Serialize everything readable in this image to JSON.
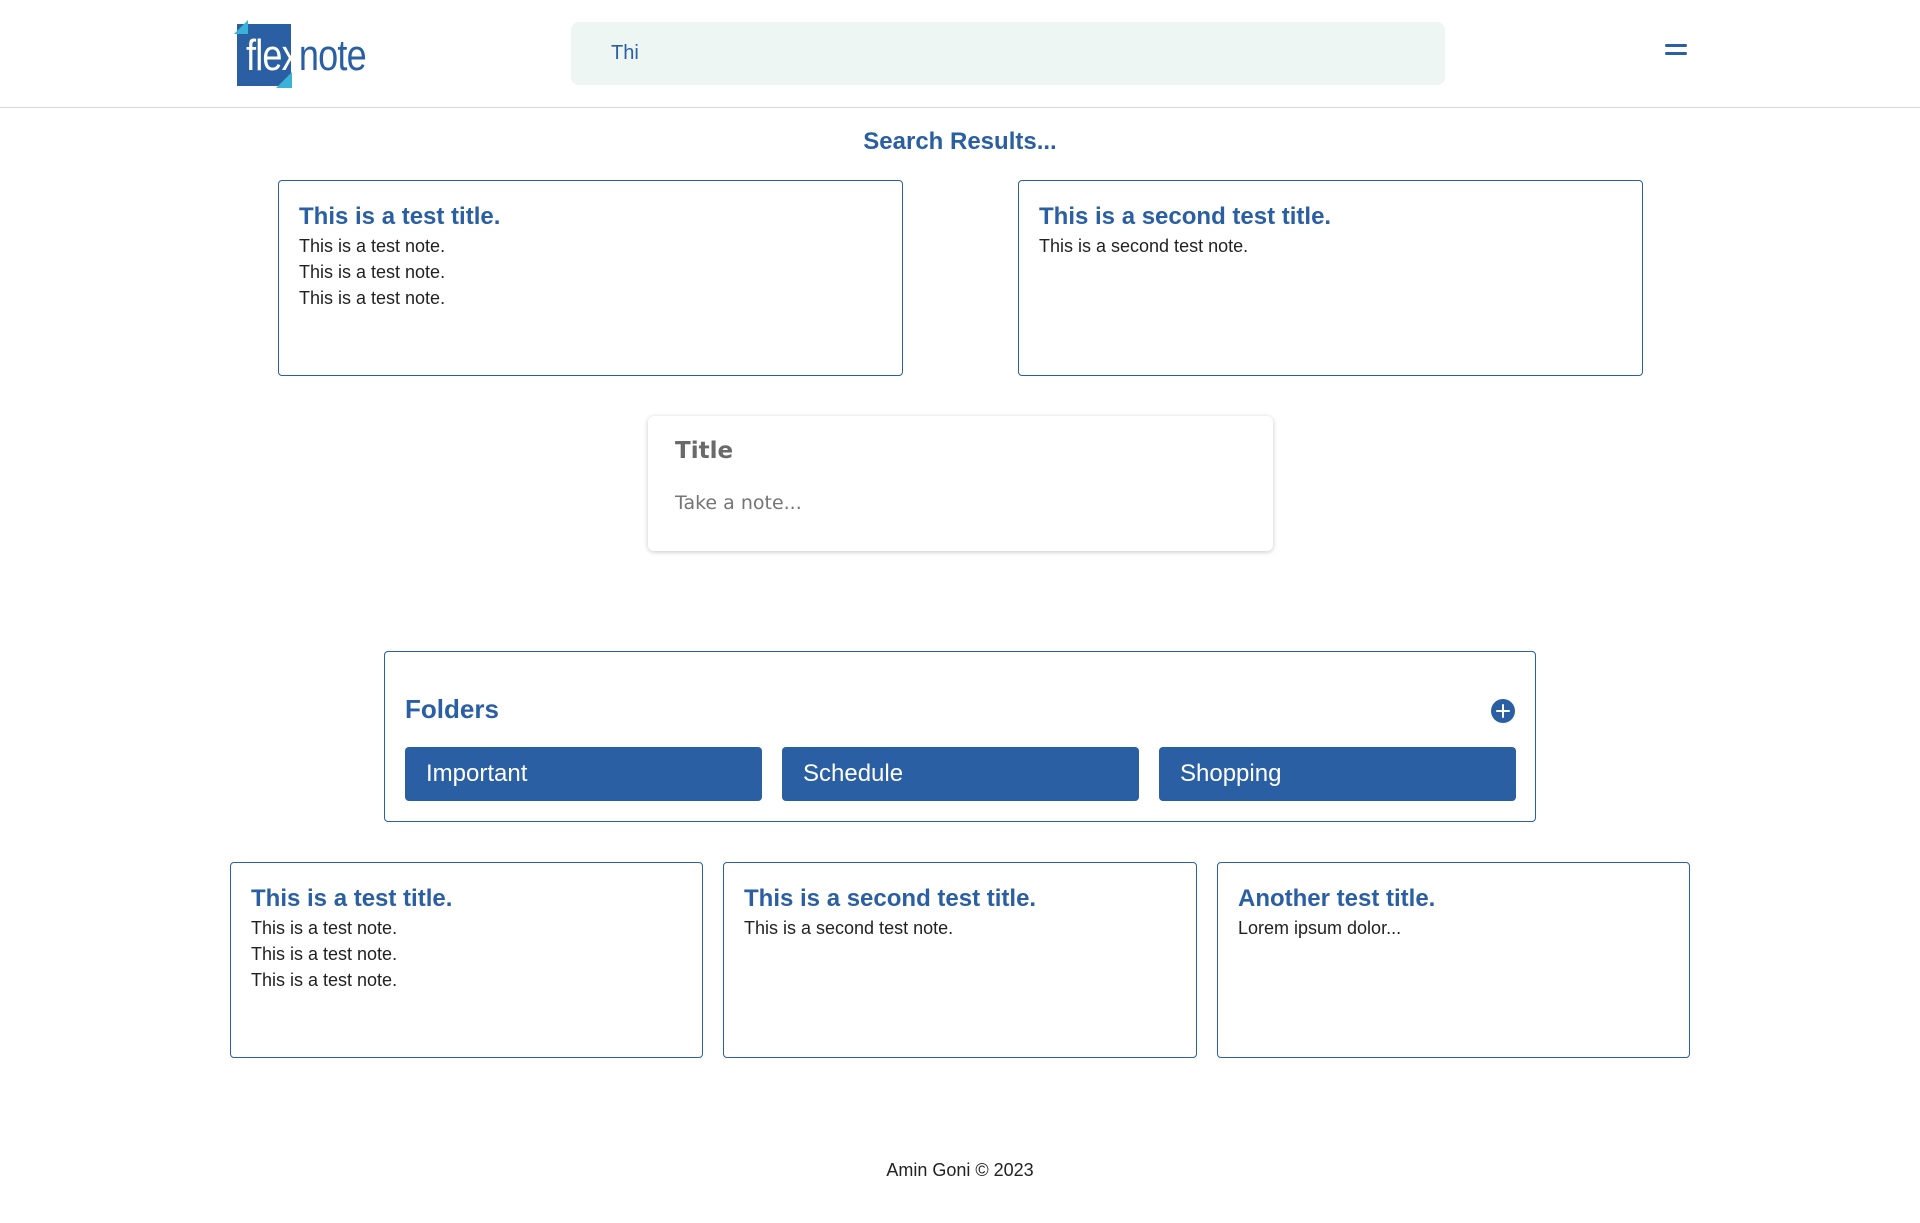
{
  "header": {
    "logo_text_light": "flex",
    "logo_text_dark": "note",
    "search_value": "Thi",
    "menu_icon": "hamburger-menu-icon"
  },
  "search_results": {
    "heading": "Search Results...",
    "notes": [
      {
        "title": "This is a test title.",
        "body": "This is a test note.\nThis is a test note.\nThis is a test note."
      },
      {
        "title": "This is a second test title.",
        "body": "This is a second test note."
      }
    ]
  },
  "composer": {
    "title_placeholder": "Title",
    "body_placeholder": "Take a note..."
  },
  "folders": {
    "heading": "Folders",
    "add_icon": "plus-circle-icon",
    "items": [
      {
        "label": "Important"
      },
      {
        "label": "Schedule"
      },
      {
        "label": "Shopping"
      }
    ]
  },
  "notes": [
    {
      "title": "This is a test title.",
      "body": "This is a test note.\nThis is a test note.\nThis is a test note."
    },
    {
      "title": "This is a second test title.",
      "body": "This is a second test note."
    },
    {
      "title": "Another test title.",
      "body": "Lorem ipsum dolor..."
    }
  ],
  "footer": {
    "text": "Amin Goni © 2023"
  },
  "colors": {
    "primary": "#2a5fa3",
    "search_bg": "#eef6f4",
    "logo_accent": "#3bb3d8"
  }
}
